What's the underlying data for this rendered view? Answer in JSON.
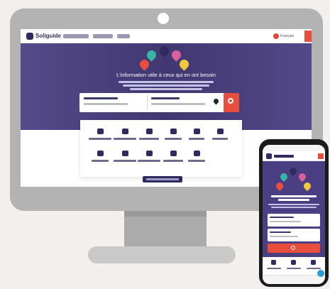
{
  "site": {
    "brand": "Soliguide",
    "language": "Français",
    "hero_title": "L'information utile à ceux qui en ont besoin"
  },
  "colors": {
    "brand_navy": "#2f2b5e",
    "hero_purple": "#4a3f82",
    "accent_red": "#e94e3d",
    "pin_green": "#35b6a7",
    "pin_pink": "#d8619c",
    "pin_yellow": "#f2c83c"
  },
  "icons": [
    "logo-icon",
    "map-pin-icon",
    "search-icon",
    "category-icon",
    "flag-icon"
  ]
}
